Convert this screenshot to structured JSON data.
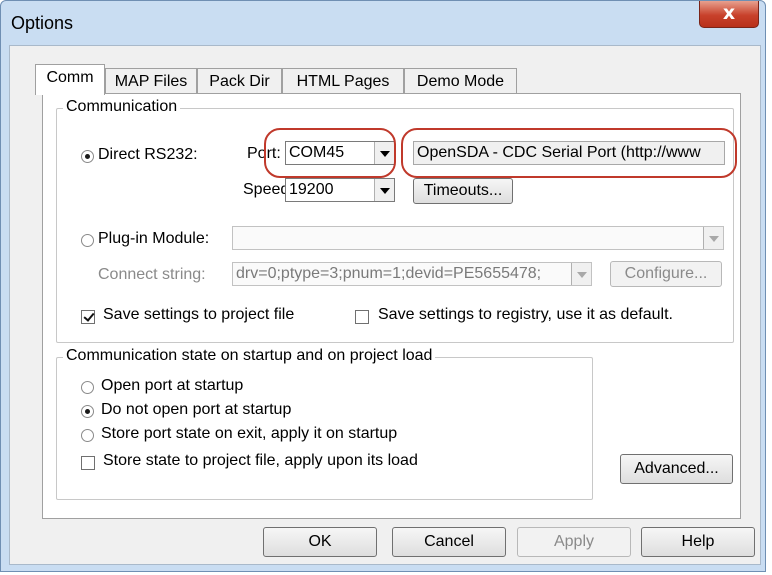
{
  "window": {
    "title": "Options",
    "close_glyph": "x"
  },
  "tabs": [
    {
      "label": "Comm",
      "active": true
    },
    {
      "label": "MAP Files",
      "active": false
    },
    {
      "label": "Pack Dir",
      "active": false
    },
    {
      "label": "HTML Pages",
      "active": false
    },
    {
      "label": "Demo Mode",
      "active": false
    }
  ],
  "communication": {
    "group_label": "Communication",
    "direct_rs232": {
      "label": "Direct RS232:",
      "selected": true
    },
    "port": {
      "label": "Port:",
      "value": "COM45",
      "description": "OpenSDA - CDC Serial Port (http://www"
    },
    "speed": {
      "label": "Speed:",
      "value": "19200"
    },
    "timeouts_button": "Timeouts...",
    "plugin_module": {
      "label": "Plug-in Module:",
      "selected": false,
      "value": ""
    },
    "connect_string": {
      "label": "Connect string:",
      "value": "drv=0;ptype=3;pnum=1;devid=PE5655478;"
    },
    "configure_button": "Configure...",
    "save_to_project": {
      "label": "Save settings to project file",
      "checked": true
    },
    "save_to_registry": {
      "label": "Save settings to registry, use it as default.",
      "checked": false
    }
  },
  "startup_state": {
    "group_label": "Communication state on startup and on project load",
    "options": [
      {
        "label": "Open port at startup",
        "selected": false
      },
      {
        "label": "Do not open port at startup",
        "selected": true
      },
      {
        "label": "Store port state on exit, apply it on startup",
        "selected": false
      }
    ],
    "store_to_project": {
      "label": "Store state to project file, apply upon its load",
      "checked": false
    }
  },
  "advanced_button": "Advanced...",
  "footer": {
    "ok": "OK",
    "cancel": "Cancel",
    "apply": "Apply",
    "help": "Help"
  },
  "colors": {
    "highlight_ring": "#c0392b",
    "title_bar": "#c9ddf2"
  }
}
